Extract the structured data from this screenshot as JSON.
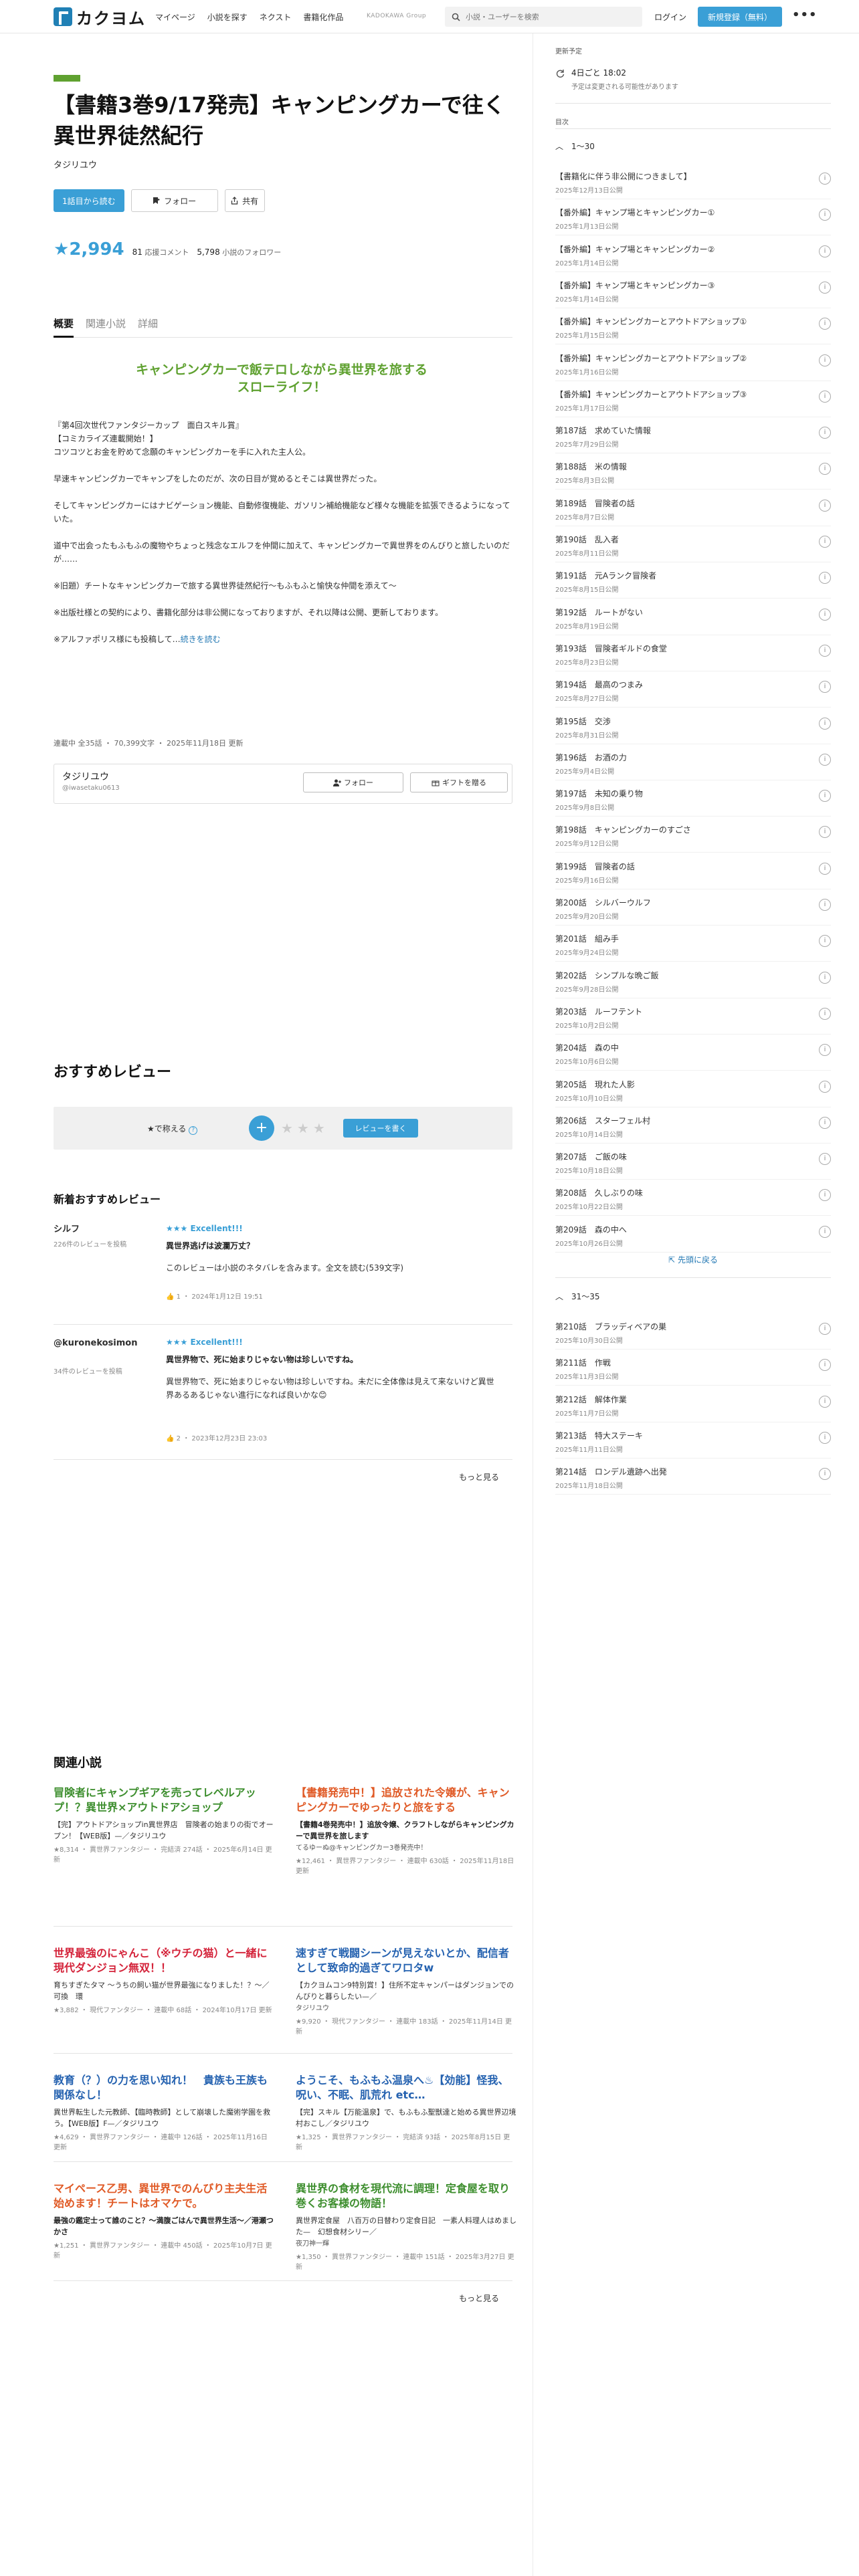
{
  "header": {
    "logo_text": "カクヨム",
    "nav": [
      "マイページ",
      "小説を探す",
      "ネクスト",
      "書籍化作品"
    ],
    "kadokawa": "KADOKAWA Group",
    "search_placeholder": "小説・ユーザーを検索",
    "login": "ログイン",
    "signup": "新規登録（無料）",
    "more": "•••"
  },
  "work": {
    "title": "【書籍3巻9/17発売】キャンピングカーで往く異世界徒然紀行",
    "author": "タジリユウ",
    "btn_read": "1話目から読む",
    "btn_follow": "フォロー",
    "btn_share": "共有",
    "stars": "2,994",
    "reviews_count": "81",
    "reviews_label": "応援コメント",
    "followers_count": "5,798",
    "followers_label": "小説のフォロワー",
    "tabs": [
      "概要",
      "関連小説",
      "詳細"
    ],
    "catchcopy": "キャンピングカーで飯テロしながら異世界を旅するスローライフ！",
    "intro": [
      "『第4回次世代ファンタジーカップ　面白スキル賞』\n【コミカライズ連載開始！】\nコツコツとお金を貯めて念願のキャンピングカーを手に入れた主人公。",
      "早速キャンピングカーでキャンプをしたのだが、次の日目が覚めるとそこは異世界だった。",
      "そしてキャンピングカーにはナビゲーション機能、自動修復機能、ガソリン補給機能など様々な機能を拡張できるようになっていた。",
      "道中で出会ったもふもふの魔物やちょっと残念なエルフを仲間に加えて、キャンピングカーで異世界をのんびりと旅したいのだが……",
      "※旧題）チートなキャンピングカーで旅する異世界徒然紀行〜もふもふと愉快な仲間を添えて〜",
      "※出版社様との契約により、書籍化部分は非公開になっておりますが、それ以降は公開、更新しております。",
      "※アルファポリス様にも投稿して…"
    ],
    "intro_more": "続きを読む",
    "meta": "連載中 全35話 ・ 70,399文字 ・ 2025年11月18日 更新",
    "author_card": {
      "name": "タジリユウ",
      "id": "@iwasetaku0613",
      "follow": "フォロー",
      "gift": "ギフトを贈る"
    }
  },
  "reviews": {
    "heading": "おすすめレビュー",
    "star_label": "★で称える",
    "help": "?",
    "write": "レビューを書く",
    "new_heading": "新着おすすめレビュー",
    "items": [
      {
        "name": "シルフ",
        "count": "226件のレビューを投稿",
        "stars": "★★★ Excellent!!!",
        "title": "異世界逃げは波瀾万丈？",
        "body": "このレビューは小説のネタバレを含みます。全文を読む(539文字)",
        "likes": "1",
        "date": "2024年1月12日 19:51"
      },
      {
        "name": "@kuronekosimon",
        "count": "34件のレビューを投稿",
        "stars": "★★★ Excellent!!!",
        "title": "異世界物で、死に始まりじゃない物は珍しいですね。",
        "body": "異世界物で、死に始まりじゃない物は珍しいですね。未だに全体像は見えて来ないけど異世界あるあるじゃない進行になれば良いかな😊",
        "likes": "2",
        "date": "2023年12月23日 23:03"
      }
    ],
    "more": "もっと見る"
  },
  "related": {
    "heading": "関連小説",
    "items": [
      {
        "title": "冒険者にキャンプギアを売ってレベルアップ！？異世界×アウトドアショップ",
        "color": "#3d8e2e",
        "sub": "【完】アウトドアショップin異世界店　冒険者の始まりの街でオープン！【WEB版】—／タジリユウ",
        "meta": "★8,314 ・ 異世界ファンタジー ・ 完結済 274話 ・ 2025年6月14日 更新"
      },
      {
        "title": "【書籍発売中！】追放された令嬢が、キャンピングカーでゆったりと旅をする",
        "color": "#e05a26",
        "sub": "【書籍4巻発売中！】追放令嬢、クラフトしながらキャンピングカーで異世界を旅します",
        "sub2": "てるゆーぬ@キャンピングカー3巻発売中！",
        "meta": "★12,461 ・ 異世界ファンタジー ・ 連載中 630話 ・ 2025年11月18日 更新"
      },
      {
        "title": "世界最強のにゃんこ（※ウチの猫）と一緒に現代ダンジョン無双！！",
        "color": "#d4233a",
        "sub": "育ちすぎたタマ 〜うちの飼い猫が世界最強になりました！？〜／可換　環",
        "meta": "★3,882 ・ 現代ファンタジー ・ 連載中 68話 ・ 2024年10月17日 更新"
      },
      {
        "title": "速すぎて戦闘シーンが見えないとか、配信者として致命的過ぎてワロタw",
        "color": "#2562b0",
        "sub": "【カクヨムコン9特別賞！】住所不定キャンパーはダンジョンでのんびりと暮らしたい—／",
        "sub2": "タジリユウ",
        "meta": "★9,920 ・ 現代ファンタジー ・ 連載中 183話 ・ 2025年11月14日 更新"
      },
      {
        "title": "教育（？）の力を思い知れ！　貴族も王族も関係なし！",
        "color": "#2562b0",
        "sub": "異世界転生した元教師、【臨時教師】として崩壊した魔術学園を救う。【WEB版】F—／タジリユウ",
        "meta": "★4,629 ・ 異世界ファンタジー ・ 連載中 126話 ・ 2025年11月16日 更新"
      },
      {
        "title": "ようこそ、もふもふ温泉へ♨【効能】怪我、呪い、不眠、肌荒れ etc…",
        "color": "#2562b0",
        "sub": "【完】スキル【万能温泉】で、もふもふ聖獣達と始める異世界辺境村おこし／タジリユウ",
        "meta": "★1,325 ・ 異世界ファンタジー ・ 完結済 93話 ・ 2025年8月15日 更新"
      },
      {
        "title": "マイペース乙男、異世界でのんびり主夫生活始めます！チートはオマケで。",
        "color": "#e05a26",
        "sub": "最強の鑑定士って誰のこと？〜満腹ごはんで異世界生活〜／港瀬つかさ",
        "meta": "★1,251 ・ 異世界ファンタジー ・ 連載中 450話 ・ 2025年10月7日 更新"
      },
      {
        "title": "異世界の食材を現代流に調理！定食屋を取り巻くお客様の物語！",
        "color": "#3d8e2e",
        "sub": "異世界定食屋　八百万の日替わり定食日記　一素人料理人はめました—　幻想食材シリー／",
        "sub2": "夜刀神一輝",
        "meta": "★1,350 ・ 異世界ファンタジー ・ 連載中 151話 ・ 2025年3月27日 更新"
      }
    ],
    "more": "もっと見る"
  },
  "sidebar": {
    "update_label": "更新予定",
    "update_time": "4日ごと 18:02",
    "update_note": "予定は変更される可能性があります",
    "toc_label": "目次",
    "group1": "1〜30",
    "group2": "31〜35",
    "backtop": "先頭に戻る",
    "episodes1": [
      {
        "t": "【書籍化に伴う非公開につきまして】",
        "d": "2025年12月13日公開"
      },
      {
        "t": "【番外編】キャンプ場とキャンピングカー①",
        "d": "2025年1月13日公開"
      },
      {
        "t": "【番外編】キャンプ場とキャンピングカー②",
        "d": "2025年1月14日公開"
      },
      {
        "t": "【番外編】キャンプ場とキャンピングカー③",
        "d": "2025年1月14日公開"
      },
      {
        "t": "【番外編】キャンピングカーとアウトドアショップ①",
        "d": "2025年1月15日公開"
      },
      {
        "t": "【番外編】キャンピングカーとアウトドアショップ②",
        "d": "2025年1月16日公開"
      },
      {
        "t": "【番外編】キャンピングカーとアウトドアショップ③",
        "d": "2025年1月17日公開"
      },
      {
        "t": "第187話　求めていた情報",
        "d": "2025年7月29日公開"
      },
      {
        "t": "第188話　米の情報",
        "d": "2025年8月3日公開"
      },
      {
        "t": "第189話　冒険者の話",
        "d": "2025年8月7日公開"
      },
      {
        "t": "第190話　乱入者",
        "d": "2025年8月11日公開"
      },
      {
        "t": "第191話　元Aランク冒険者",
        "d": "2025年8月15日公開"
      },
      {
        "t": "第192話　ルートがない",
        "d": "2025年8月19日公開"
      },
      {
        "t": "第193話　冒険者ギルドの食堂",
        "d": "2025年8月23日公開"
      },
      {
        "t": "第194話　最高のつまみ",
        "d": "2025年8月27日公開"
      },
      {
        "t": "第195話　交渉",
        "d": "2025年8月31日公開"
      },
      {
        "t": "第196話　お酒の力",
        "d": "2025年9月4日公開"
      },
      {
        "t": "第197話　未知の乗り物",
        "d": "2025年9月8日公開"
      },
      {
        "t": "第198話　キャンピングカーのすごさ",
        "d": "2025年9月12日公開"
      },
      {
        "t": "第199話　冒険者の話",
        "d": "2025年9月16日公開"
      },
      {
        "t": "第200話　シルバーウルフ",
        "d": "2025年9月20日公開"
      },
      {
        "t": "第201話　組み手",
        "d": "2025年9月24日公開"
      },
      {
        "t": "第202話　シンプルな晩ご飯",
        "d": "2025年9月28日公開"
      },
      {
        "t": "第203話　ルーフテント",
        "d": "2025年10月2日公開"
      },
      {
        "t": "第204話　森の中",
        "d": "2025年10月6日公開"
      },
      {
        "t": "第205話　現れた人影",
        "d": "2025年10月10日公開"
      },
      {
        "t": "第206話　スターフェル村",
        "d": "2025年10月14日公開"
      },
      {
        "t": "第207話　ご飯の味",
        "d": "2025年10月18日公開"
      },
      {
        "t": "第208話　久しぶりの味",
        "d": "2025年10月22日公開"
      },
      {
        "t": "第209話　森の中へ",
        "d": "2025年10月26日公開"
      }
    ],
    "episodes2": [
      {
        "t": "第210話　ブラッディベアの巣",
        "d": "2025年10月30日公開"
      },
      {
        "t": "第211話　作戦",
        "d": "2025年11月3日公開"
      },
      {
        "t": "第212話　解体作業",
        "d": "2025年11月7日公開"
      },
      {
        "t": "第213話　特大ステーキ",
        "d": "2025年11月11日公開"
      },
      {
        "t": "第214話　ロンデル遺跡へ出発",
        "d": "2025年11月18日公開"
      }
    ]
  },
  "colors": {
    "accent": "#3a9fd6",
    "green": "#5fa130",
    "link": "#2479b4"
  }
}
